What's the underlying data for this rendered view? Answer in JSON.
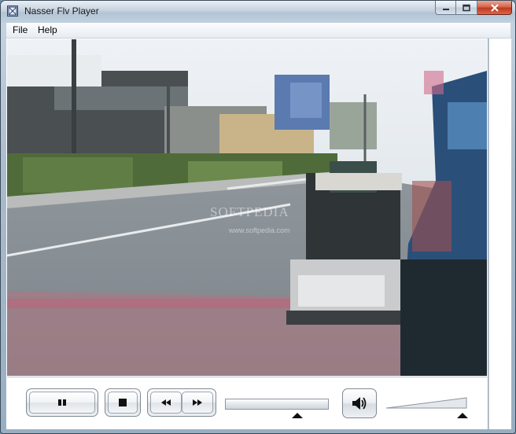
{
  "window": {
    "title": "Nasser Flv Player",
    "icon": "app-grid-icon"
  },
  "menu": {
    "items": [
      {
        "label": "File"
      },
      {
        "label": "Help"
      }
    ]
  },
  "video": {
    "watermark": "SOFTPEDIA",
    "watermark_url": "www.softpedia.com"
  },
  "controls": {
    "pause_icon": "pause-icon",
    "stop_icon": "stop-icon",
    "rewind_icon": "rewind-icon",
    "forward_icon": "fast-forward-icon",
    "volume_icon": "speaker-icon",
    "seek_position": 0.7,
    "volume_level": 0.95
  },
  "colors": {
    "title_bar": "#c5d2de",
    "close_button": "#c0391f"
  }
}
